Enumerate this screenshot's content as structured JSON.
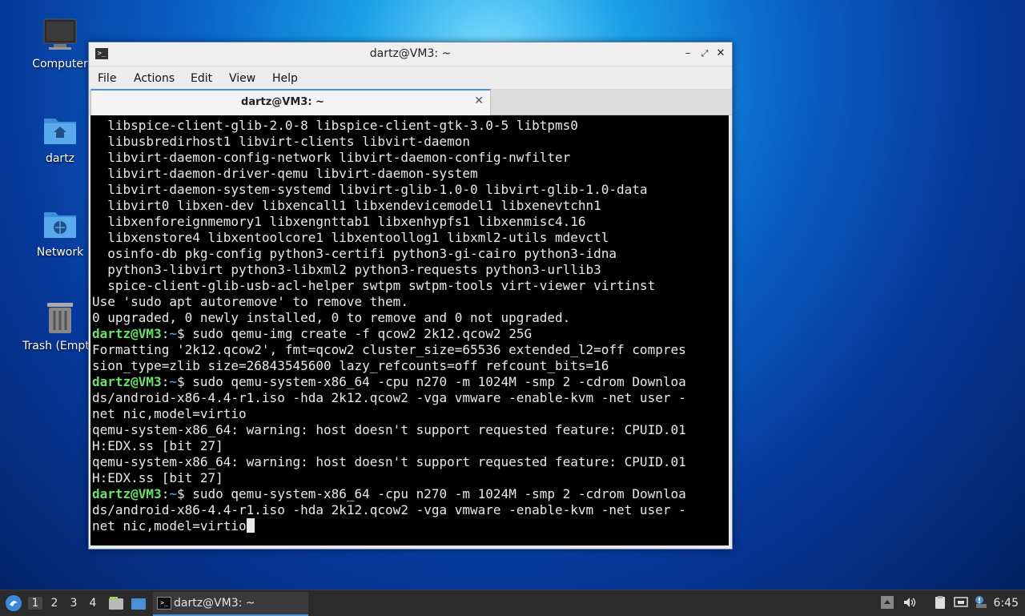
{
  "desktop": {
    "icons": [
      {
        "label": "Computer"
      },
      {
        "label": "dartz"
      },
      {
        "label": "Network"
      },
      {
        "label": "Trash (Empty)"
      }
    ]
  },
  "window": {
    "title": "dartz@VM3: ~",
    "menu": [
      "File",
      "Actions",
      "Edit",
      "View",
      "Help"
    ],
    "tab": {
      "label": "dartz@VM3: ~"
    }
  },
  "terminal": {
    "lines": [
      {
        "text": "  libspice-client-glib-2.0-8 libspice-client-gtk-3.0-5 libtpms0"
      },
      {
        "text": "  libusbredirhost1 libvirt-clients libvirt-daemon"
      },
      {
        "text": "  libvirt-daemon-config-network libvirt-daemon-config-nwfilter"
      },
      {
        "text": "  libvirt-daemon-driver-qemu libvirt-daemon-system"
      },
      {
        "text": "  libvirt-daemon-system-systemd libvirt-glib-1.0-0 libvirt-glib-1.0-data"
      },
      {
        "text": "  libvirt0 libxen-dev libxencall1 libxendevicemodel1 libxenevtchn1"
      },
      {
        "text": "  libxenforeignmemory1 libxengnttab1 libxenhypfs1 libxenmisc4.16"
      },
      {
        "text": "  libxenstore4 libxentoolcore1 libxentoollog1 libxml2-utils mdevctl"
      },
      {
        "text": "  osinfo-db pkg-config python3-certifi python3-gi-cairo python3-idna"
      },
      {
        "text": "  python3-libvirt python3-libxml2 python3-requests python3-urllib3"
      },
      {
        "text": "  spice-client-glib-usb-acl-helper swtpm swtpm-tools virt-viewer virtinst"
      },
      {
        "text": "Use 'sudo apt autoremove' to remove them."
      },
      {
        "text": "0 upgraded, 0 newly installed, 0 to remove and 0 not upgraded."
      },
      {
        "user": "dartz@VM3",
        "path": "~",
        "text": "$ sudo qemu-img create -f qcow2 2k12.qcow2 25G"
      },
      {
        "text": "Formatting '2k12.qcow2', fmt=qcow2 cluster_size=65536 extended_l2=off compres"
      },
      {
        "text": "sion_type=zlib size=26843545600 lazy_refcounts=off refcount_bits=16"
      },
      {
        "user": "dartz@VM3",
        "path": "~",
        "text": "$ sudo qemu-system-x86_64 -cpu n270 -m 1024M -smp 2 -cdrom Downloa"
      },
      {
        "text": "ds/android-x86-4.4-r1.iso -hda 2k12.qcow2 -vga vmware -enable-kvm -net user -"
      },
      {
        "text": "net nic,model=virtio"
      },
      {
        "text": "qemu-system-x86_64: warning: host doesn't support requested feature: CPUID.01"
      },
      {
        "text": "H:EDX.ss [bit 27]"
      },
      {
        "text": "qemu-system-x86_64: warning: host doesn't support requested feature: CPUID.01"
      },
      {
        "text": "H:EDX.ss [bit 27]"
      },
      {
        "user": "dartz@VM3",
        "path": "~",
        "text": "$ sudo qemu-system-x86_64 -cpu n270 -m 1024M -smp 2 -cdrom Downloa"
      },
      {
        "text": "ds/android-x86-4.4-r1.iso -hda 2k12.qcow2 -vga vmware -enable-kvm -net user -"
      },
      {
        "text": "net nic,model=virtio",
        "cursor": true
      }
    ]
  },
  "taskbar": {
    "workspaces": [
      "1",
      "2",
      "3",
      "4"
    ],
    "task_label": "dartz@VM3: ~",
    "clock": "6:45"
  },
  "colors": {
    "prompt_user": "#6ae16a",
    "prompt_path": "#6aa9ff",
    "tab_accent": "#4a90d9"
  }
}
